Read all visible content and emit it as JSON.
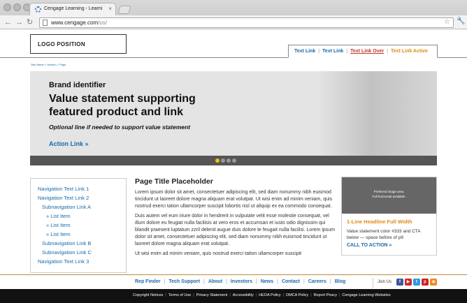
{
  "browser": {
    "tab_title": "Cengage Learning - Learni",
    "tab_close": "×",
    "url_host": "www.cengage.com",
    "url_path": "/us/"
  },
  "header": {
    "logo_text": "LOGO POSITION",
    "util_links": [
      "Text Link",
      "Text Link",
      "Text Link Over",
      "Text Link Active"
    ],
    "util_separator": "|"
  },
  "breadcrumb": "Site Name > Section > Page",
  "hero": {
    "brand": "Brand identifier",
    "title": "Value statement supporting featured product and link",
    "optional_line": "Optional line if needed to support value statement",
    "action_link": "Action Link »",
    "slide_count": 4,
    "active_slide": 1
  },
  "sidenav": {
    "items": [
      {
        "label": "Navigation Text Link 1",
        "level": 0
      },
      {
        "label": "Navigation Text Link 2",
        "level": 0
      },
      {
        "label": "Subnavigation Link A",
        "level": 1
      },
      {
        "label": "» List Item",
        "level": 2
      },
      {
        "label": "» List Item",
        "level": 2
      },
      {
        "label": "» List Item",
        "level": 2
      },
      {
        "label": "Subnavigation Link B",
        "level": 1
      },
      {
        "label": "Subnavigation Link C",
        "level": 1
      },
      {
        "label": "Navigation Text Link 3",
        "level": 0
      }
    ]
  },
  "main": {
    "title": "Page Title Placeholder",
    "paragraphs": [
      "Lorem ipsum dolor sit amet, consectetuer adipiscing elit, sed diam nonummy nibh euismod tincidunt ut laoreet dolore magna aliquam erat volutpat. Ut wisi enim ad minim veniam, quis nostrud exerci tation ullamcorper suscipit lobortis nisl ut aliquip ex ea commodo consequat.",
      "Duis autem vel eum iriure dolor in hendrerit in vulputate velit esse molestie consequat, vel illum dolore eu feugiat nulla facilisis at vero eros et accumsan et iusto odio dignissim qui blandit praesent luptatum zzril delenit augue duis dolore te feugait nulla facilisi. Lorem ipsum dolor sit amet, consectetuer adipiscing elit, sed diam nonummy nibh euismod tincidunt ut laoreet dolore magna aliquam erat volutpat.",
      "Ut wisi enim ad minim veniam, quis nostrud exerci tation ullamcorper suscipit"
    ]
  },
  "promo": {
    "image_text_1": "Preferred image area.",
    "image_text_2": "Full horizontal available.",
    "headline": "1-Line Headline Full Width",
    "text": "Value statement color #333 and CTA below — space before of p9",
    "cta": "CALL TO ACTION »"
  },
  "footer": {
    "links": [
      "Rep Finder",
      "Tech Support",
      "About",
      "Investors",
      "News",
      "Contact",
      "Careers",
      "Blog"
    ],
    "join_label": "Join Us",
    "social": [
      {
        "icon": "facebook-icon",
        "glyph": "f",
        "color": "#3b5998"
      },
      {
        "icon": "youtube-icon",
        "glyph": "▶",
        "color": "#cc2a2a"
      },
      {
        "icon": "twitter-icon",
        "glyph": "t",
        "color": "#2b9be0"
      },
      {
        "icon": "pinterest-icon",
        "glyph": "p",
        "color": "#cb2027"
      },
      {
        "icon": "rss-icon",
        "glyph": "◉",
        "color": "#f08a20"
      }
    ],
    "legal": [
      "Copyright Notices",
      "Terms of Use",
      "Privacy Statement",
      "Accessibility",
      "HEOA Policy",
      "DMCA Policy",
      "Report Piracy",
      "Cengage Learning Websites"
    ]
  },
  "colors": {
    "link": "#1a6aa8",
    "accent": "#e08a12",
    "hover": "#c0392b"
  }
}
